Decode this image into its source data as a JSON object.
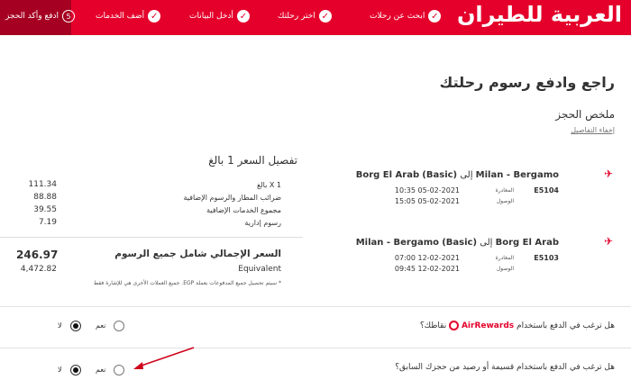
{
  "header": {
    "logo": "العربية للطيران",
    "steps": [
      {
        "label": "ابحث عن رحلات",
        "state": "done"
      },
      {
        "label": "اختر رحلتك",
        "state": "done"
      },
      {
        "label": "أدخل البيانات",
        "state": "done"
      },
      {
        "label": "أضف الخدمات",
        "state": "done"
      },
      {
        "label": "ادفع وأكد الحجز",
        "state": "active",
        "number": "5"
      }
    ],
    "colors": {
      "brand": "#e4002b",
      "active": "#a50021"
    }
  },
  "page": {
    "title": "راجع وادفع رسوم رحلتك",
    "summary": "ملخص الحجز",
    "hide_details": "إخفاء التفاصيل"
  },
  "flights": [
    {
      "from": "Milan - Bergamo",
      "to": "Borg El Arab",
      "fare": "(Basic)",
      "connector": "إلى",
      "number": "E5104",
      "departure_label": "المغادرة",
      "arrival_label": "الوصول",
      "departure": "10:35 05-02-2021",
      "arrival": "15:05 05-02-2021"
    },
    {
      "from": "Borg El Arab",
      "to": "Milan - Bergamo",
      "fare": "(Basic)",
      "connector": "إلى",
      "number": "E5103",
      "departure_label": "المغادرة",
      "arrival_label": "الوصول",
      "departure": "07:00 12-02-2021",
      "arrival": "09:45 12-02-2021"
    }
  ],
  "fare": {
    "title": "تفصيل السعر 1 بالغ",
    "rows": [
      {
        "label": "1 X بالغ",
        "value": "111.34"
      },
      {
        "label": "ضرائب المطار والرسوم الإضافية",
        "value": "88.88"
      },
      {
        "label": "مجموع الخدمات الإضافية",
        "value": "39.55"
      },
      {
        "label": "رسوم إدارية",
        "value": "7.19"
      }
    ],
    "total_label": "السعر الإجمالي شامل جميع الرسوم",
    "total_value": "246.97",
    "equivalent_label": "Equivalent",
    "equivalent_value": "4,472.82",
    "note": "* سيتم تحصيل جميع المدفوعات بعملة EGP. جميع العملات الأخرى هي للإشارة فقط"
  },
  "questions": [
    {
      "pre": "هل ترغب في الدفع باستخدام",
      "brand_air": "Air",
      "brand_rewards": "Rewards",
      "post": "نقاطك؟",
      "yes": "نعم",
      "no": "لا",
      "selected": "no"
    },
    {
      "text": "هل ترغب في الدفع باستخدام قسيمة أو رصيد من حجزك السابق؟",
      "yes": "نعم",
      "no": "لا",
      "selected": "no"
    }
  ]
}
